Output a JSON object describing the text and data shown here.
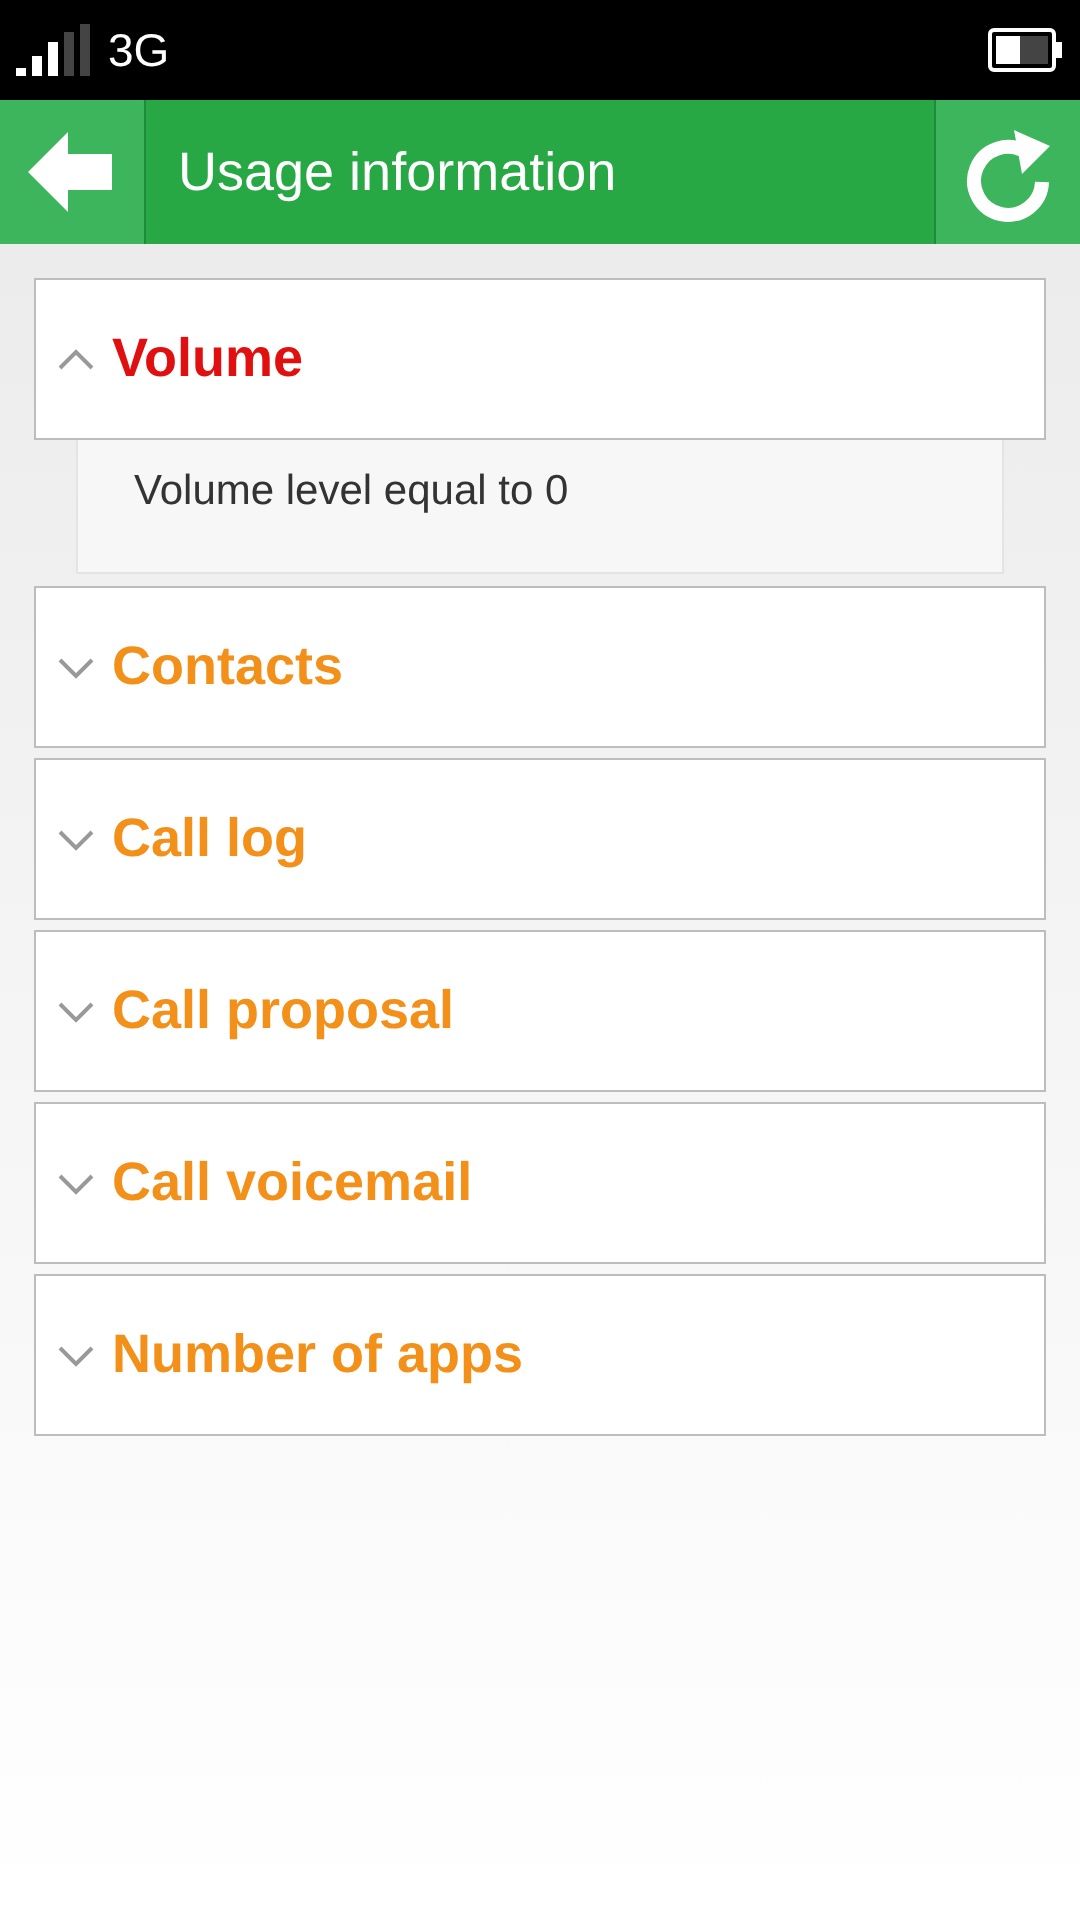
{
  "status_bar": {
    "network": "3G"
  },
  "app_bar": {
    "title": "Usage information"
  },
  "sections": [
    {
      "title": "Volume",
      "expanded": true,
      "content": "Volume level equal to 0"
    },
    {
      "title": "Contacts",
      "expanded": false
    },
    {
      "title": "Call log",
      "expanded": false
    },
    {
      "title": "Call proposal",
      "expanded": false
    },
    {
      "title": "Call voicemail",
      "expanded": false
    },
    {
      "title": "Number of apps",
      "expanded": false
    }
  ]
}
